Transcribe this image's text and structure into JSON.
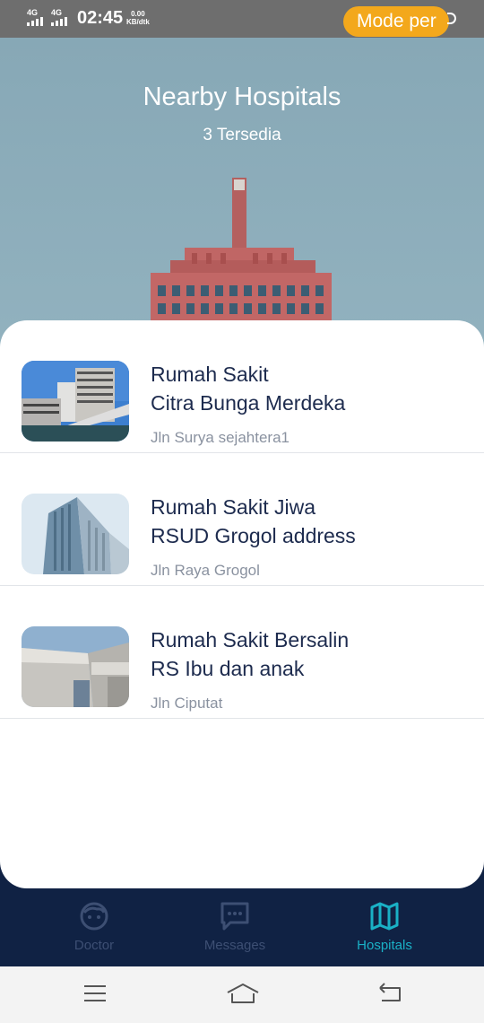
{
  "status_bar": {
    "sim1": "4G",
    "sim2": "4G",
    "time": "02:45",
    "net_speed_value": "0.00",
    "net_speed_unit": "KB/dtk",
    "mode_pill": "Mode per"
  },
  "header": {
    "title": "Nearby Hospitals",
    "subtitle": "3 Tersedia"
  },
  "hospitals": [
    {
      "name_line1": "Rumah Sakit",
      "name_line2": "Citra Bunga Merdeka",
      "address": "Jln Surya sejahtera1"
    },
    {
      "name_line1": "Rumah Sakit Jiwa",
      "name_line2": "RSUD Grogol address",
      "address": "Jln Raya Grogol"
    },
    {
      "name_line1": "Rumah Sakit Bersalin",
      "name_line2": "RS Ibu dan anak",
      "address": "Jln Ciputat"
    }
  ],
  "bottom_nav": {
    "items": [
      {
        "label": "Doctor",
        "icon": "face-icon",
        "active": false
      },
      {
        "label": "Messages",
        "icon": "chat-icon",
        "active": false
      },
      {
        "label": "Hospitals",
        "icon": "map-icon",
        "active": true
      }
    ]
  },
  "colors": {
    "header_bg": "#8aabb9",
    "nav_bg": "#102244",
    "active_tab": "#1ab1c6",
    "inactive_tab": "#3d4f73",
    "status_pill": "#f3a81c",
    "title_text": "#1d2b4e",
    "address_text": "#8a92a0"
  }
}
